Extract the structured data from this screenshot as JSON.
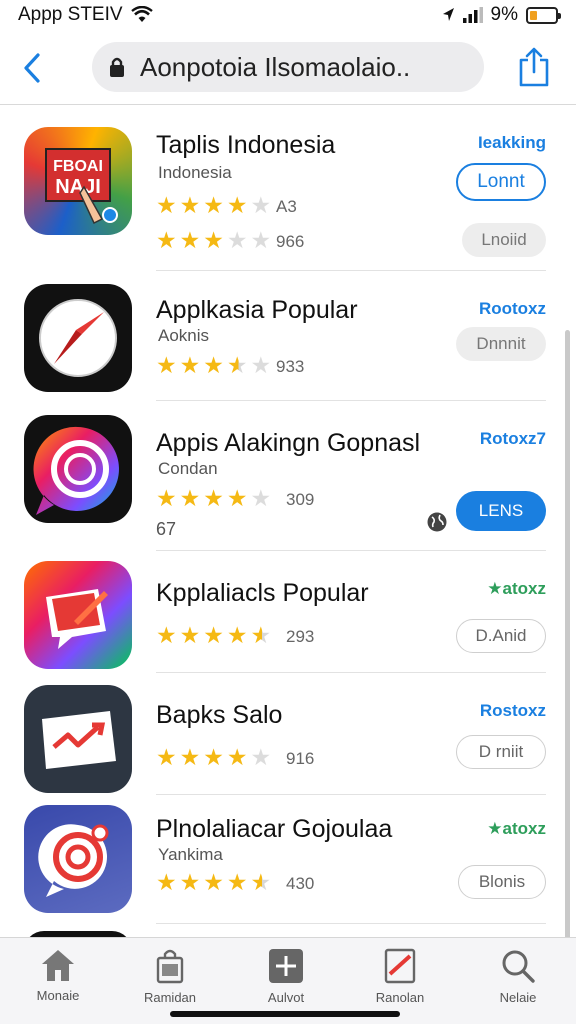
{
  "status_bar": {
    "carrier": "Appp STEIV",
    "battery": "9%",
    "battery_level": 0.3
  },
  "nav": {
    "url": "Aonpotoia Ilsomaolaio.."
  },
  "apps": [
    {
      "name": "Taplis Indonesia",
      "subtitle": "Indonesia",
      "rating": 4,
      "rating_count": "A3",
      "rank": "Ieakking",
      "action": "Lonnt",
      "action_style": "outline-blue",
      "extra_rating": 3,
      "extra_count": "966",
      "extra_action": "Lnoiid"
    },
    {
      "name": "Applkasia Popular",
      "subtitle": "Aoknis",
      "rating": 3.5,
      "rating_count": "933",
      "rank": "Rootoxz",
      "action": "Dnnnit",
      "action_style": "grey"
    },
    {
      "name": "Appis Alakingn Gopnasl",
      "subtitle": "Condan",
      "rating": 4,
      "rating_count": "309",
      "extra_text": "67",
      "rank": "Rotoxz7",
      "action": "LENS",
      "action_style": "solid-blue"
    },
    {
      "name": "Kpplaliacls Popular",
      "subtitle": "",
      "rating": 4.5,
      "rating_count": "293",
      "rank": "★atoxz",
      "action": "D.Anid",
      "action_style": "outline-grey"
    },
    {
      "name": "Bapks Salo",
      "subtitle": "",
      "rating": 4,
      "rating_count": "916",
      "rank": "Rostoxz",
      "action": "D rniit",
      "action_style": "outline-grey"
    },
    {
      "name": "Plnolaliacar Gojoulaa",
      "subtitle": "Yankima",
      "rating": 4.5,
      "rating_count": "430",
      "rank": "★atoxz",
      "action": "Blonis",
      "action_style": "outline-grey"
    }
  ],
  "tabs": [
    {
      "label": "Monaie",
      "icon": "home-icon"
    },
    {
      "label": "Ramidan",
      "icon": "bag-icon"
    },
    {
      "label": "Aulvot",
      "icon": "plus-square-icon"
    },
    {
      "label": "Ranolan",
      "icon": "note-icon"
    },
    {
      "label": "Nelaie",
      "icon": "search-icon"
    }
  ]
}
